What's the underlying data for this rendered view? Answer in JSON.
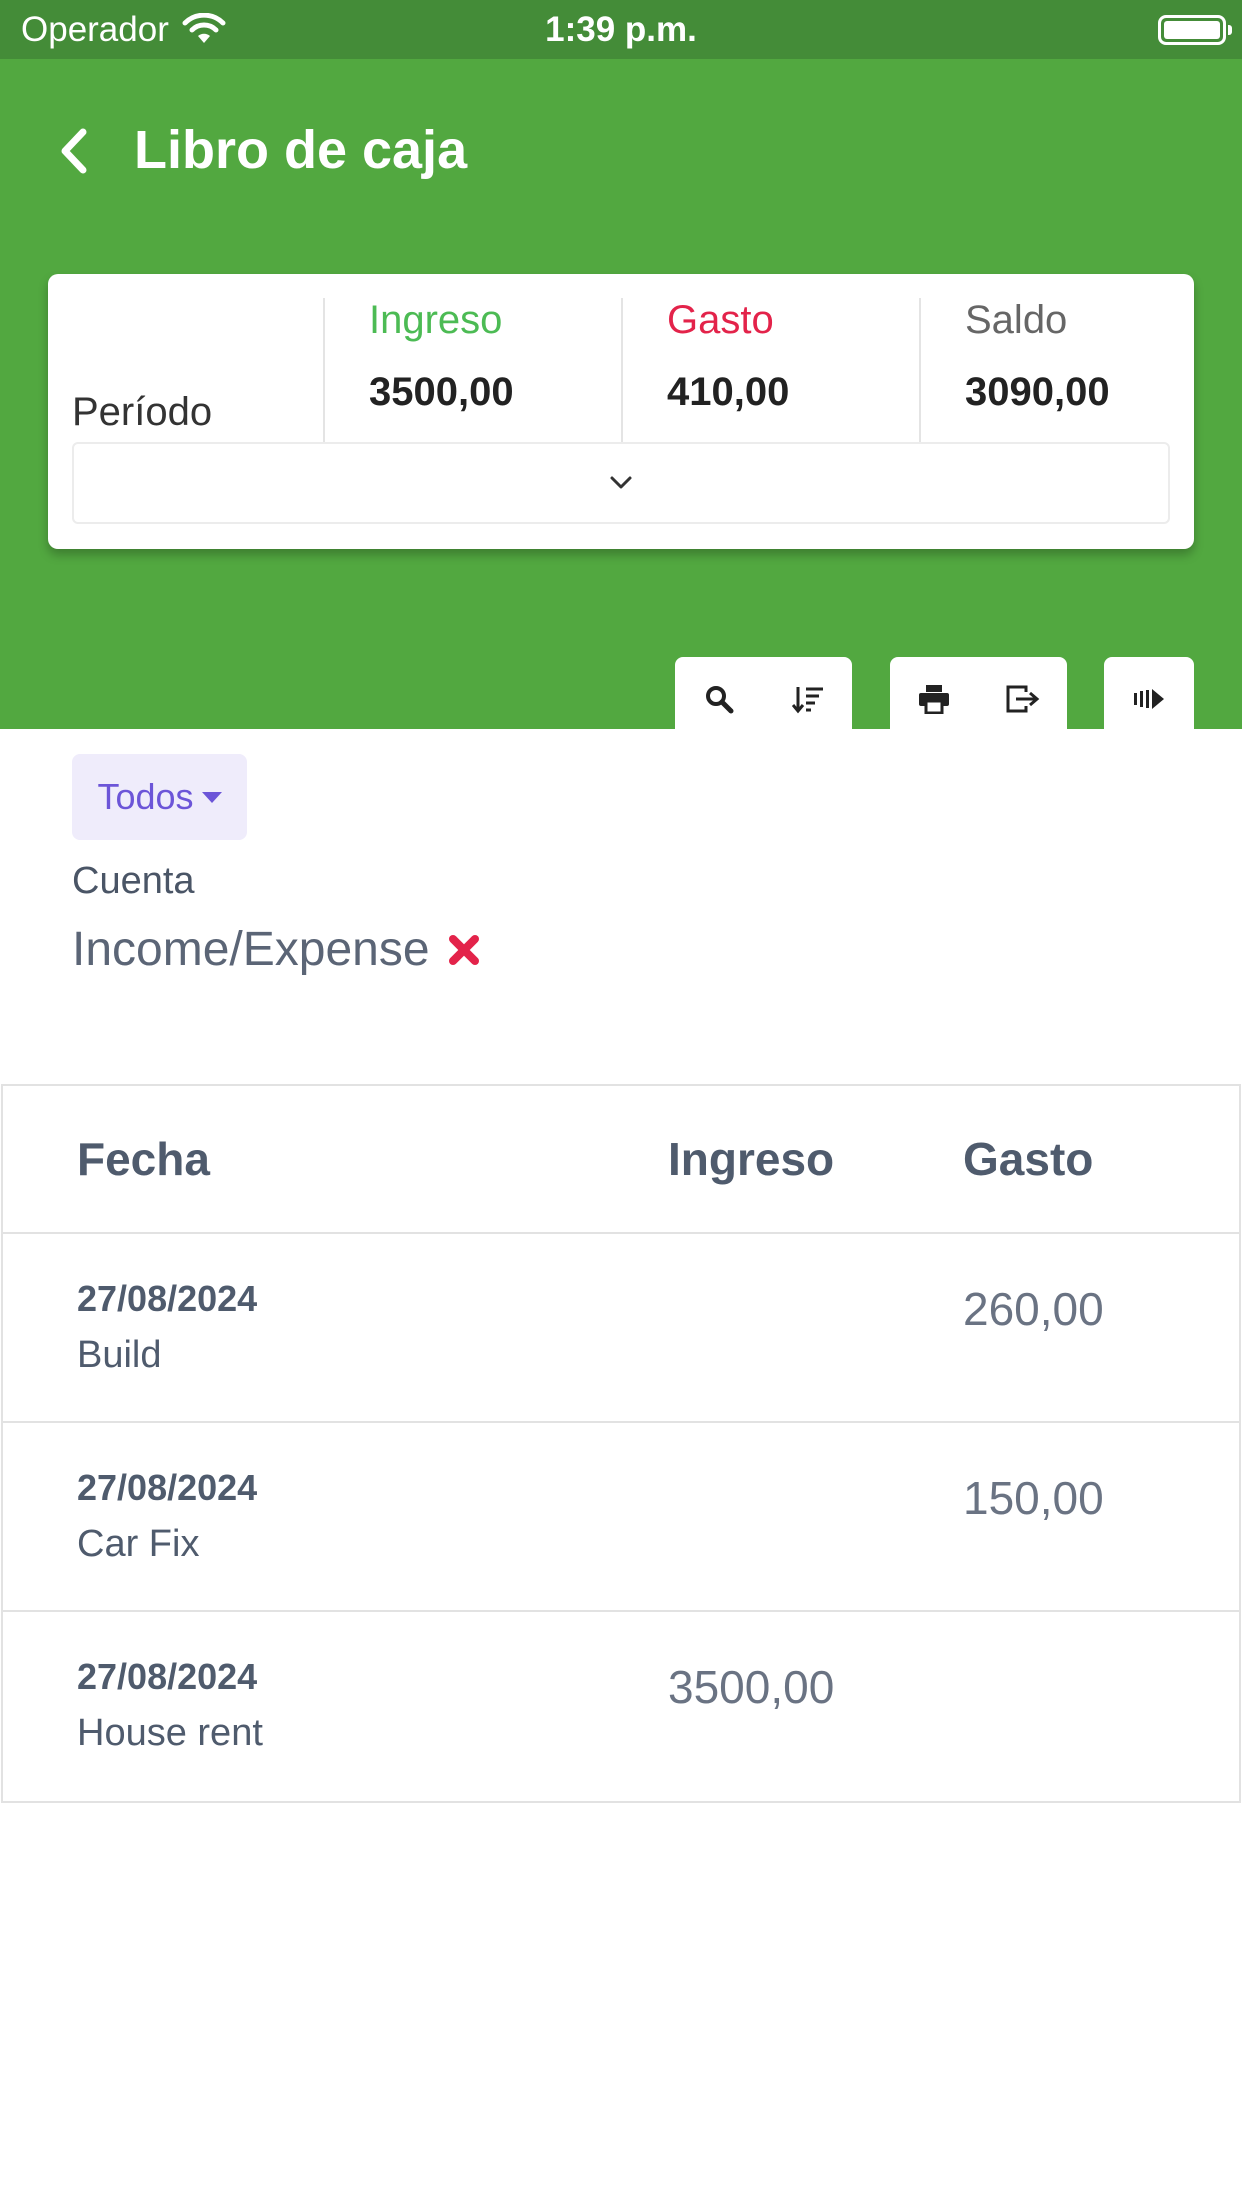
{
  "status_bar": {
    "carrier": "Operador",
    "time": "1:39 p.m."
  },
  "header": {
    "title": "Libro de caja"
  },
  "summary": {
    "period_label": "Período",
    "income_label": "Ingreso",
    "income_value": "3500,00",
    "expense_label": "Gasto",
    "expense_value": "410,00",
    "balance_label": "Saldo",
    "balance_value": "3090,00",
    "colors": {
      "income": "#4cbb54",
      "expense": "#e3234a",
      "balance": "#666666"
    }
  },
  "toolbar": {
    "icons": [
      "search-icon",
      "sort-icon",
      "print-icon",
      "export-icon",
      "skip-forward-icon"
    ]
  },
  "filter": {
    "chip_label": "Todos",
    "account_label": "Cuenta",
    "account_value": "Income/Expense"
  },
  "table": {
    "headers": {
      "date": "Fecha",
      "income": "Ingreso",
      "expense": "Gasto"
    },
    "rows": [
      {
        "date": "27/08/2024",
        "description": "Build",
        "income": "",
        "expense": "260,00"
      },
      {
        "date": "27/08/2024",
        "description": "Car Fix",
        "income": "",
        "expense": "150,00"
      },
      {
        "date": "27/08/2024",
        "description": "House rent",
        "income": "3500,00",
        "expense": ""
      }
    ]
  },
  "theme": {
    "header_green": "#52a840",
    "status_green": "#448c38",
    "accent_purple": "#6c55d8"
  }
}
